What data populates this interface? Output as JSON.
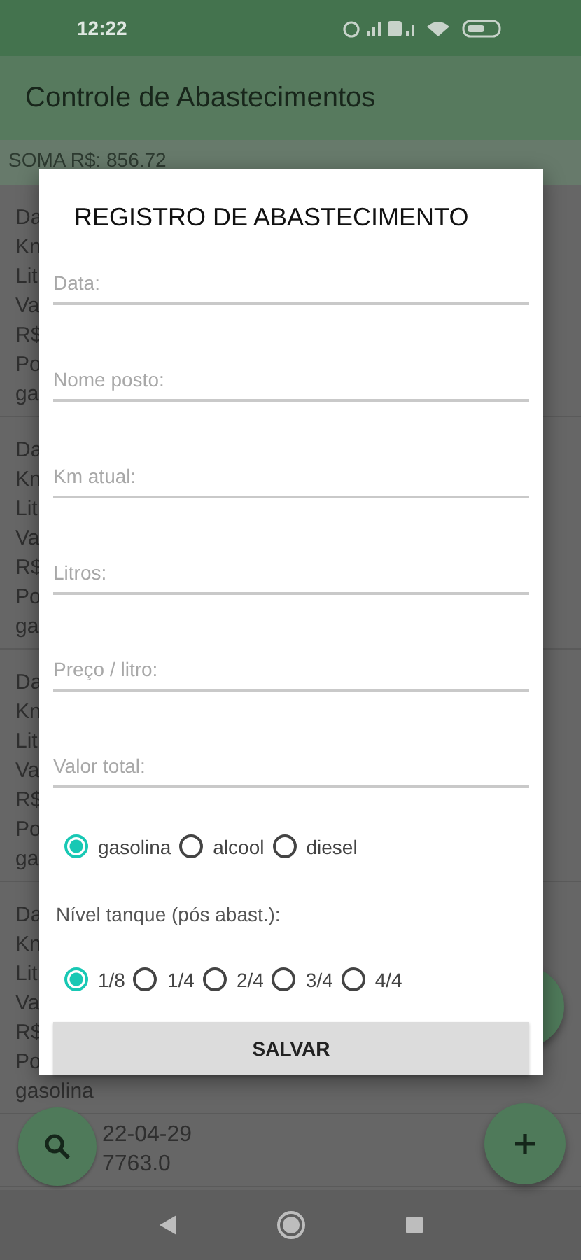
{
  "status_bar": {
    "time": "12:22"
  },
  "app_bar": {
    "title": "Controle de Abastecimentos"
  },
  "summary": "SOMA R$: 856.72",
  "records": [
    {
      "lines": [
        "Da",
        "Kn",
        "Lit",
        "Va",
        "R$",
        "Po",
        "ga"
      ]
    },
    {
      "lines": [
        "Da",
        "Kn",
        "Lit",
        "Va",
        "R$",
        "Po",
        "ga"
      ]
    },
    {
      "lines": [
        "Da",
        "Kn",
        "Lit",
        "Va",
        "R$",
        "Po",
        "ga"
      ]
    },
    {
      "lines": [
        "Da",
        "Kn",
        "Lit",
        "Va",
        "R$",
        "Po",
        "gasolina"
      ]
    },
    {
      "lines": [
        "22-04-29",
        "7763.0"
      ]
    }
  ],
  "dialog": {
    "title": "REGISTRO DE ABASTECIMENTO",
    "fields": [
      {
        "placeholder": "Data:"
      },
      {
        "placeholder": "Nome posto:"
      },
      {
        "placeholder": "Km atual:"
      },
      {
        "placeholder": "Litros:"
      },
      {
        "placeholder": "Preço / litro:"
      },
      {
        "placeholder": "Valor total:"
      }
    ],
    "fuel_options": [
      {
        "label": "gasolina",
        "selected": true
      },
      {
        "label": "alcool",
        "selected": false
      },
      {
        "label": "diesel",
        "selected": false
      }
    ],
    "tank_label": "Nível tanque (pós abast.):",
    "tank_options": [
      {
        "label": "1/8",
        "selected": true
      },
      {
        "label": "1/4",
        "selected": false
      },
      {
        "label": "2/4",
        "selected": false
      },
      {
        "label": "3/4",
        "selected": false
      },
      {
        "label": "4/4",
        "selected": false
      }
    ],
    "save_button": "SALVAR"
  }
}
